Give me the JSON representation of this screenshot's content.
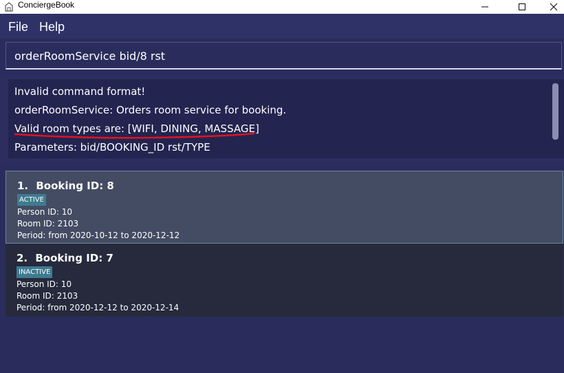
{
  "window": {
    "title": "ConciergeBook"
  },
  "menu": {
    "file": "File",
    "help": "Help"
  },
  "command": {
    "value": "orderRoomService bid/8 rst"
  },
  "result": {
    "lines": [
      "Invalid command format!",
      "orderRoomService: Orders room service for booking.",
      "Valid room types are: [WIFI, DINING, MASSAGE]",
      "Parameters: bid/BOOKING_ID rst/TYPE"
    ]
  },
  "bookings": [
    {
      "index": "1.",
      "title": "Booking ID: 8",
      "status": "ACTIVE",
      "person": "Person ID: 10",
      "room": "Room ID: 2103",
      "period": "Period: from 2020-10-12 to 2020-12-12"
    },
    {
      "index": "2.",
      "title": "Booking ID: 7",
      "status": "INACTIVE",
      "person": "Person ID: 10",
      "room": "Room ID: 2103",
      "period": "Period: from 2020-12-12 to 2020-12-14"
    }
  ],
  "colors": {
    "background": "#2a2d5c",
    "result_bg": "#232450",
    "selected_card": "#444c63",
    "card": "#262a3c",
    "badge": "#3e7b91",
    "annotation": "#e0141f"
  }
}
